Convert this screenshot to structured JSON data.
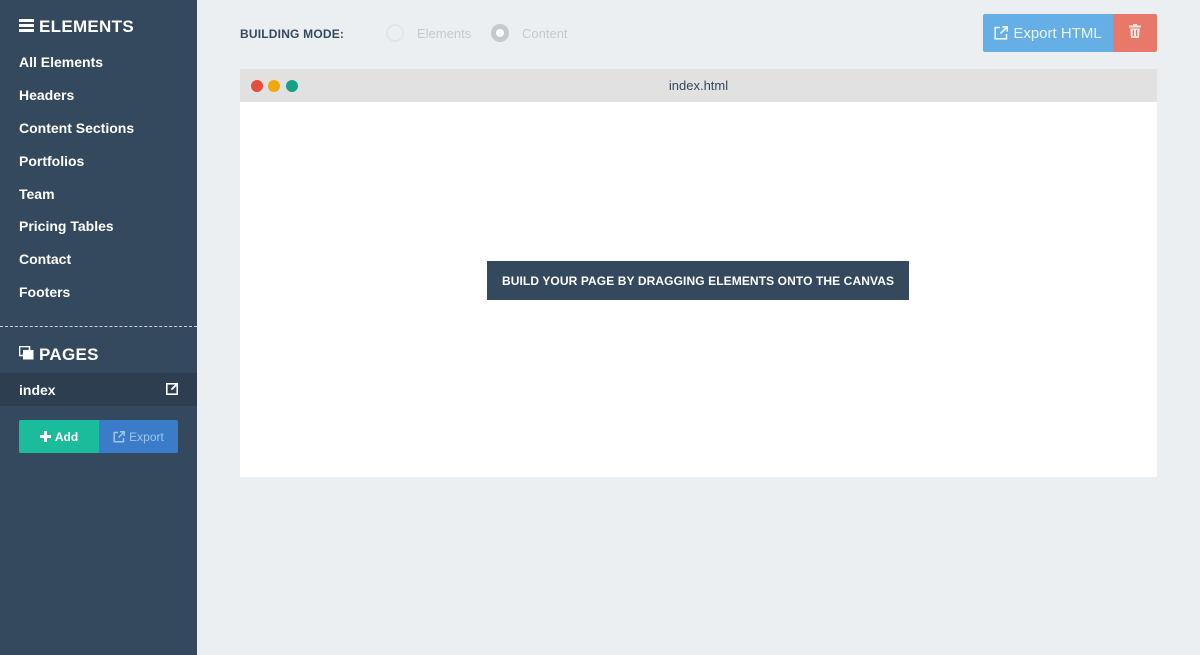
{
  "sidebar": {
    "elements_heading": "ELEMENTS",
    "menu_items": [
      {
        "label": "All Elements"
      },
      {
        "label": "Headers"
      },
      {
        "label": "Content Sections"
      },
      {
        "label": "Portfolios"
      },
      {
        "label": "Team"
      },
      {
        "label": "Pricing Tables"
      },
      {
        "label": "Contact"
      },
      {
        "label": "Footers"
      }
    ],
    "pages_heading": "PAGES",
    "pages": [
      {
        "label": "index"
      }
    ],
    "add_label": "Add",
    "export_label": "Export"
  },
  "topbar": {
    "mode_label": "BUILDING MODE:",
    "mode_options": [
      "Elements",
      "Content"
    ],
    "export_html_label": "Export HTML"
  },
  "canvas": {
    "filename": "index.html",
    "placeholder": "BUILD YOUR PAGE BY DRAGGING ELEMENTS ONTO THE CANVAS"
  },
  "colors": {
    "sidebar_bg": "#34495e",
    "sidebar_active": "#2c3e50",
    "add_green": "#1abc9c",
    "export_blue": "#3b7cc9",
    "export_html_blue": "#65afe6",
    "delete_red": "#e8786a",
    "page_bg": "#eceff1"
  },
  "icons": {
    "elements_heading": "bars-icon",
    "pages_heading": "copy-icon",
    "page_edit": "edit-icon",
    "add": "plus-icon",
    "export": "external-link-icon",
    "delete": "trash-icon"
  }
}
